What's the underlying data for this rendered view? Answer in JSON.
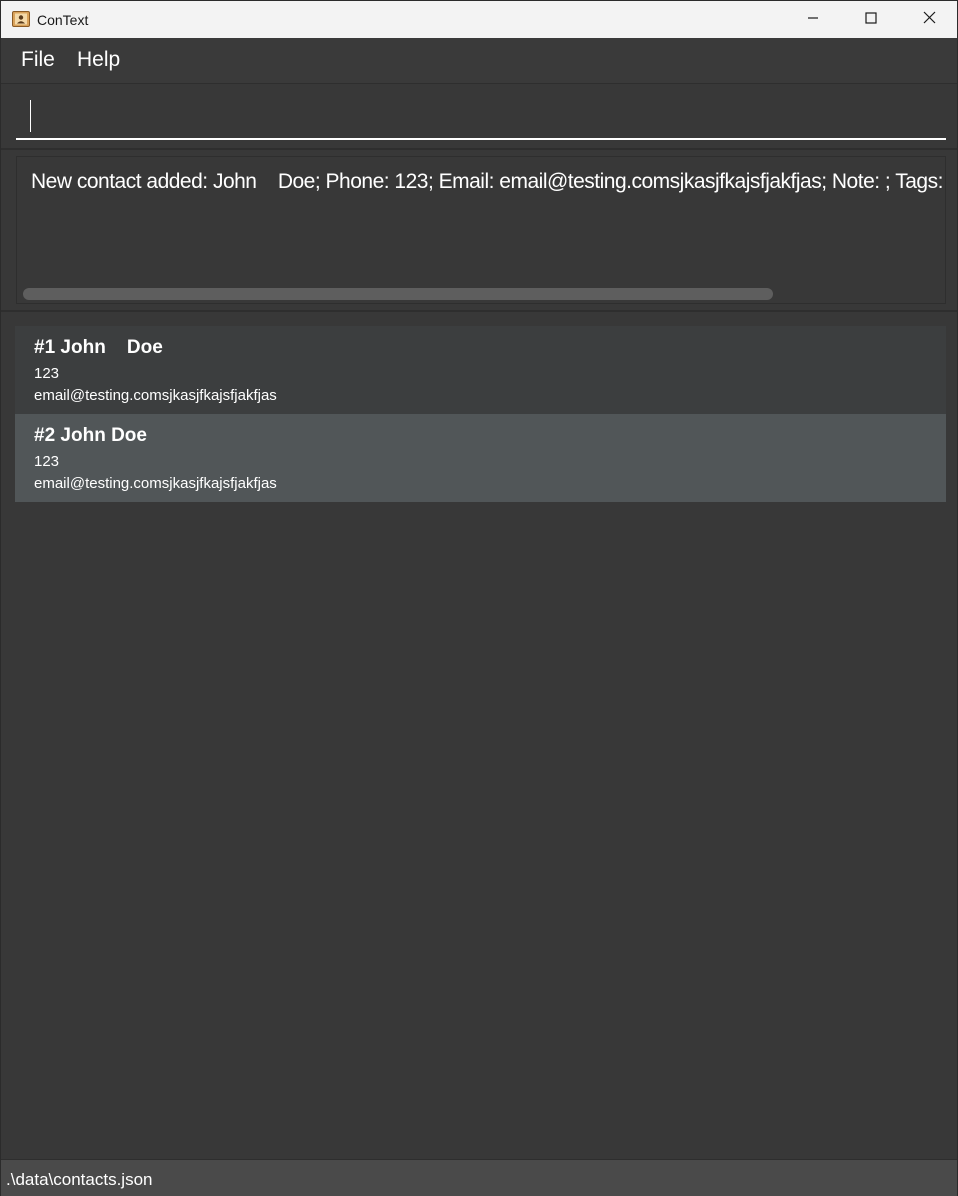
{
  "window": {
    "title": "ConText"
  },
  "menu": {
    "items": [
      "File",
      "Help"
    ]
  },
  "command": {
    "value": ""
  },
  "result": {
    "text": "New contact added: John    Doe; Phone: 123; Email: email@testing.comsjkasjfkajsfjakfjas; Note: ; Tags:"
  },
  "contacts": [
    {
      "name": "#1 John    Doe",
      "phone": "123",
      "email": "email@testing.comsjkasjfkajsfjakfjas"
    },
    {
      "name": "#2 John Doe",
      "phone": "123",
      "email": "email@testing.comsjkasjfkajsfjakfjas"
    }
  ],
  "status": {
    "path": ".\\data\\contacts.json"
  },
  "colors": {
    "background": "#383838",
    "selected_card": "#515658",
    "card": "#3c3e3f",
    "titlebar": "#f3f3f3",
    "statusbar": "#4a4a4a"
  },
  "icons": {
    "app": "contact-book-icon",
    "minimize": "minimize-icon",
    "maximize": "maximize-icon",
    "close": "close-icon"
  }
}
